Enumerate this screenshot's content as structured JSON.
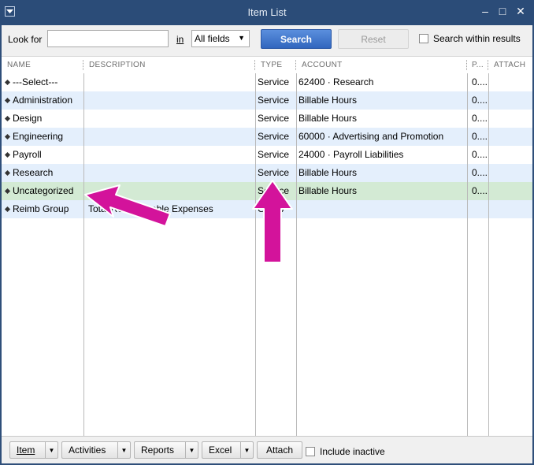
{
  "window": {
    "title": "Item List",
    "controls": {
      "minimize": "–",
      "maximize": "□",
      "close": "✕"
    }
  },
  "toolbar": {
    "look_for_label": "Look for",
    "look_for_value": "",
    "in_label": "in",
    "field_select_value": "All fields",
    "search_label": "Search",
    "reset_label": "Reset",
    "search_within_label": "Search within results"
  },
  "columns": {
    "name": "NAME",
    "description": "DESCRIPTION",
    "type": "TYPE",
    "account": "ACCOUNT",
    "price": "P...",
    "attach": "ATTACH"
  },
  "rows": [
    {
      "name": "---Select---",
      "description": "",
      "type": "Service",
      "account": "62400 · Research",
      "price": "0...."
    },
    {
      "name": "Administration",
      "description": "",
      "type": "Service",
      "account": "Billable Hours",
      "price": "0...."
    },
    {
      "name": "Design",
      "description": "",
      "type": "Service",
      "account": "Billable Hours",
      "price": "0...."
    },
    {
      "name": "Engineering",
      "description": "",
      "type": "Service",
      "account": "60000 · Advertising and Promotion",
      "price": "0...."
    },
    {
      "name": "Payroll",
      "description": "",
      "type": "Service",
      "account": "24000 · Payroll Liabilities",
      "price": "0...."
    },
    {
      "name": "Research",
      "description": "",
      "type": "Service",
      "account": "Billable Hours",
      "price": "0...."
    },
    {
      "name": "Uncategorized",
      "description": "",
      "type": "Service",
      "account": "Billable Hours",
      "price": "0...."
    },
    {
      "name": "Reimb Group",
      "description": "Total Reimbursable Expenses",
      "type": "Group",
      "account": "",
      "price": ""
    }
  ],
  "footer": {
    "item_label": "Item",
    "activities_label": "Activities",
    "reports_label": "Reports",
    "excel_label": "Excel",
    "attach_label": "Attach",
    "include_inactive_label": "Include inactive"
  },
  "annotation_color": "#d3139b",
  "selected_row_color": "#d3ead4",
  "alt_row_color": "#e4effc"
}
